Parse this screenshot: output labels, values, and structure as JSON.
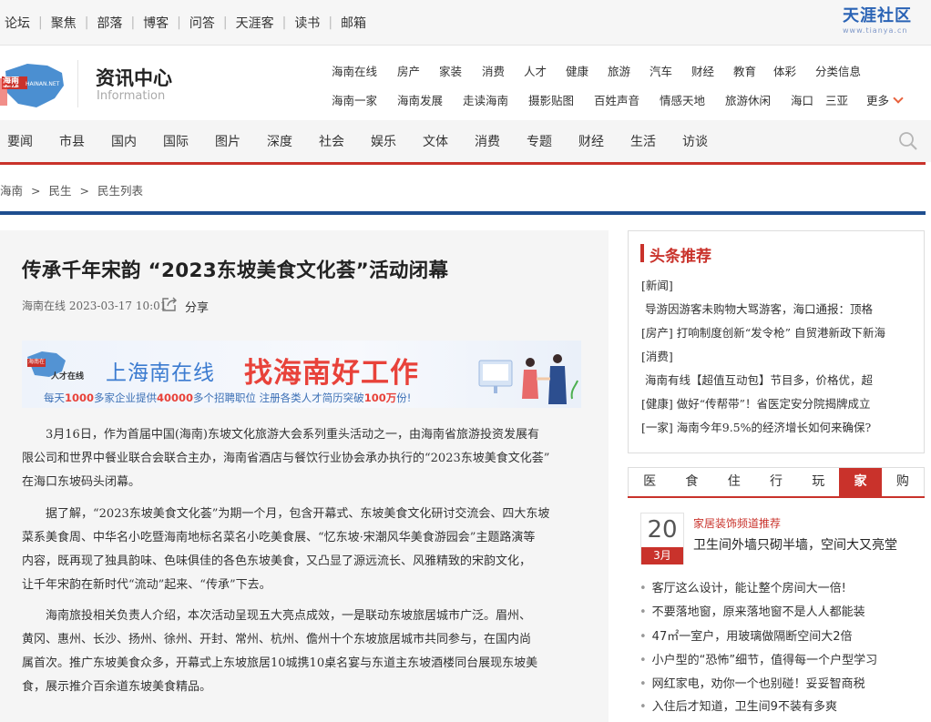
{
  "topbar": {
    "links": [
      "论坛",
      "聚焦",
      "部落",
      "博客",
      "问答",
      "天涯客",
      "读书",
      "邮箱"
    ],
    "brand": "天涯社区",
    "brand_url": "www.tianya.cn"
  },
  "site": {
    "logo_text": "海南在线",
    "logo_en": "HAINAN.NET",
    "section_title": "资讯中心",
    "section_sub": "Information"
  },
  "channels": {
    "row1": [
      "海南在线",
      "房产",
      "家装",
      "消费",
      "人才",
      "健康",
      "旅游",
      "汽车",
      "财经",
      "教育",
      "体彩",
      "分类信息"
    ],
    "row2": [
      "海南一家",
      "海南发展",
      "走读海南",
      "摄影贴图",
      "百姓声音",
      "情感天地",
      "旅游休闲",
      "海口",
      "三亚"
    ],
    "more": "更多"
  },
  "mainnav": [
    "要闻",
    "市县",
    "国内",
    "国际",
    "图片",
    "深度",
    "社会",
    "娱乐",
    "文体",
    "消费",
    "专题",
    "财经",
    "生活",
    "访谈"
  ],
  "breadcrumb": {
    "items": [
      "海南",
      "民生",
      "民生列表"
    ],
    "sep": ">"
  },
  "article": {
    "title": "传承千年宋韵 “2023东坡美食文化荟”活动闭幕",
    "source": "海南在线",
    "time": "2023-03-17 10:01",
    "share": "分享",
    "banner": {
      "brand": "海南在线",
      "brand_sub": "人才在线",
      "text1": "上海南在线",
      "text2": "找海南好工作",
      "sub_pre": "每天",
      "sub_n1": "1000",
      "sub_mid1": "多家企业提供",
      "sub_n2": "40000",
      "sub_mid2": "多个招聘职位 注册各类人才简历突破",
      "sub_n3": "100万",
      "sub_end": "份!"
    },
    "paragraphs": [
      "3月16日，作为首届中国(海南)东坡文化旅游大会系列重头活动之一，由海南省旅游投资发展有限公司和世界中餐业联合会联合主办，海南省酒店与餐饮行业协会承办执行的“2023东坡美食文化荟”在海口东坡码头闭幕。",
      "据了解，“2023东坡美食文化荟”为期一个月，包含开幕式、东坡美食文化研讨交流会、四大东坡菜系美食周、中华名小吃暨海南地标名菜名小吃美食展、“忆东坡·宋潮风华美食游园会”主题路演等内容，既再现了独具韵味、色味俱佳的各色东坡美食，又凸显了源远流长、风雅精致的宋韵文化，让千年宋韵在新时代“流动”起来、“传承”下去。",
      "海南旅投相关负责人介绍，本次活动呈现五大亮点成效，一是联动东坡旅居城市广泛。眉州、黄冈、惠州、长沙、扬州、徐州、开封、常州、杭州、儋州十个东坡旅居城市共同参与，在国内尚属首次。推广东坡美食众多，开幕式上东坡旅居10城携10桌名宴与东道主东坡酒楼同台展现东坡美食，展示推介百余道东坡美食精品。"
    ],
    "para_lines": [
      [
        "3月16日，作为首届中国(海南)东坡文化旅游大会系列重头活动之一，由海南省旅游投资发展有",
        "限公司和世界中餐业联合会联合主办，海南省酒店与餐饮行业协会承办执行的“2023东坡美食文化荟”",
        "在海口东坡码头闭幕。"
      ],
      [
        "据了解，“2023东坡美食文化荟”为期一个月，包含开幕式、东坡美食文化研讨交流会、四大东坡",
        "菜系美食周、中华名小吃暨海南地标名菜名小吃美食展、“忆东坡·宋潮风华美食游园会”主题路演等",
        "内容，既再现了独具韵味、色味俱佳的各色东坡美食，又凸显了源远流长、风雅精致的宋韵文化，",
        "让千年宋韵在新时代“流动”起来、“传承”下去。"
      ],
      [
        "海南旅投相关负责人介绍，本次活动呈现五大亮点成效，一是联动东坡旅居城市广泛。眉州、",
        "黄冈、惠州、长沙、扬州、徐州、开封、常州、杭州、儋州十个东坡旅居城市共同参与，在国内尚",
        "属首次。推广东坡美食众多，开幕式上东坡旅居10城携10桌名宴与东道主东坡酒楼同台展现东坡美",
        "食，展示推介百余道东坡美食精品。"
      ]
    ]
  },
  "headlines": {
    "title": "头条推荐",
    "items": [
      {
        "tag": "[新闻]",
        "text": ""
      },
      {
        "tag": "",
        "text": "导游因游客未购物大骂游客，海口通报：顶格"
      },
      {
        "tag": "[房产]",
        "text": "打响制度创新“发令枪” 自贸港新政下新海"
      },
      {
        "tag": "[消费]",
        "text": ""
      },
      {
        "tag": "",
        "text": "海南有线【超值互动包】节目多，价格优，超"
      },
      {
        "tag": "[健康]",
        "text": "做好“传帮带”！省医定安分院揭牌成立"
      },
      {
        "tag": "[一家]",
        "text": "海南今年9.5%的经济增长如何来确保?"
      }
    ]
  },
  "life_tabs": {
    "tabs": [
      "医",
      "食",
      "住",
      "行",
      "玩",
      "家",
      "购"
    ],
    "active": "家",
    "day": "20",
    "month": "3月",
    "category": "家居装饰频道推荐",
    "featured": "卫生间外墙只砌半墙，空间大又亮堂",
    "list": [
      "客厅这么设计，能让整个房间大一倍!",
      "不要落地窗，原来落地窗不是人人都能装",
      "47㎡一室户，用玻璃做隔断空间大2倍",
      "小户型的“恐怖”细节，值得每一个户型学习",
      "网红家电，劝你一个也别碰！妥妥智商税",
      "入住后才知道，卫生间9不装有多爽"
    ]
  },
  "colors": {
    "accent": "#c9322b",
    "nav_blue": "#1f4e8f",
    "link_blue": "#3b7bd0"
  }
}
